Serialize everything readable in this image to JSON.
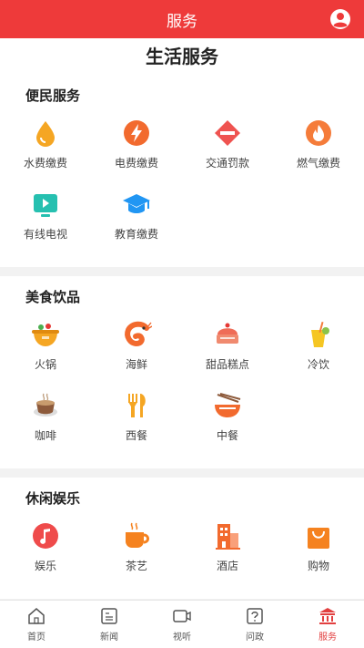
{
  "header": {
    "title": "服务"
  },
  "page_title": "生活服务",
  "sections": [
    {
      "title": "便民服务",
      "items": [
        {
          "label": "水费缴费",
          "icon": "water-drop-icon",
          "color": "#f5a623"
        },
        {
          "label": "电费缴费",
          "icon": "lightning-icon",
          "color": "#f26a2e"
        },
        {
          "label": "交通罚款",
          "icon": "no-entry-icon",
          "color": "#ef5350"
        },
        {
          "label": "燃气缴费",
          "icon": "flame-icon",
          "color": "#f57c3a"
        },
        {
          "label": "有线电视",
          "icon": "tv-icon",
          "color": "#26c0b0"
        },
        {
          "label": "教育缴费",
          "icon": "graduation-cap-icon",
          "color": "#2196f3"
        }
      ]
    },
    {
      "title": "美食饮品",
      "items": [
        {
          "label": "火锅",
          "icon": "hotpot-icon",
          "color": "#f5a623"
        },
        {
          "label": "海鲜",
          "icon": "shrimp-icon",
          "color": "#f26a2e"
        },
        {
          "label": "甜品糕点",
          "icon": "cake-icon",
          "color": "#ef6c57"
        },
        {
          "label": "冷饮",
          "icon": "cold-drink-icon",
          "color": "#f5c623"
        },
        {
          "label": "咖啡",
          "icon": "coffee-cup-icon",
          "color": "#8d5a3b"
        },
        {
          "label": "西餐",
          "icon": "fork-knife-icon",
          "color": "#f5a623"
        },
        {
          "label": "中餐",
          "icon": "noodle-bowl-icon",
          "color": "#f26a2e"
        }
      ]
    },
    {
      "title": "休闲娱乐",
      "items": [
        {
          "label": "娱乐",
          "icon": "music-note-icon",
          "color": "#ef4b4b"
        },
        {
          "label": "茶艺",
          "icon": "tea-cup-icon",
          "color": "#f5821f"
        },
        {
          "label": "酒店",
          "icon": "hotel-building-icon",
          "color": "#f26a2e"
        },
        {
          "label": "购物",
          "icon": "shopping-bag-icon",
          "color": "#f5821f"
        }
      ]
    }
  ],
  "tabs": [
    {
      "label": "首页",
      "icon": "home-icon",
      "active": false
    },
    {
      "label": "新闻",
      "icon": "news-icon",
      "active": false
    },
    {
      "label": "视听",
      "icon": "video-icon",
      "active": false
    },
    {
      "label": "问政",
      "icon": "question-icon",
      "active": false
    },
    {
      "label": "服务",
      "icon": "service-building-icon",
      "active": true
    }
  ],
  "colors": {
    "brand": "#ee3a3a",
    "active_tab": "#e24040"
  }
}
